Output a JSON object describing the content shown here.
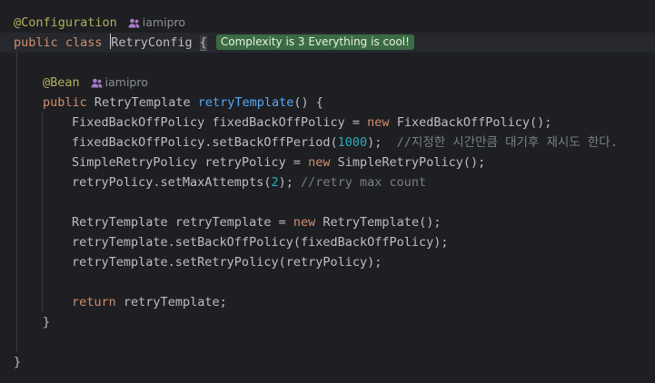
{
  "author": "iamipro",
  "complexity_badge": "Complexity is 3 Everything is cool!",
  "lines": {
    "l1": {
      "annotation": "@Configuration"
    },
    "l2": {
      "kw1": "public",
      "kw2": "class",
      "class_name": "RetryConfig",
      "brace": "{"
    },
    "l4": {
      "annotation": "@Bean"
    },
    "l5": {
      "kw": "public",
      "type": "RetryTemplate",
      "method": "retryTemplate",
      "rest": "() {"
    },
    "l6": {
      "type": "FixedBackOffPolicy",
      "var": "fixedBackOffPolicy =",
      "kw": "new",
      "ctor": "FixedBackOffPolicy();"
    },
    "l7": {
      "code_a": "fixedBackOffPolicy.setBackOffPeriod(",
      "num": "1000",
      "code_b": ");",
      "comment": "//지정한 시간만큼 대기후 재시도 한다."
    },
    "l8": {
      "type": "SimpleRetryPolicy",
      "var": "retryPolicy =",
      "kw": "new",
      "ctor": "SimpleRetryPolicy();"
    },
    "l9": {
      "code_a": "retryPolicy.setMaxAttempts(",
      "num": "2",
      "code_b": ");",
      "comment": "//retry max count"
    },
    "l11": {
      "type": "RetryTemplate",
      "var": "retryTemplate =",
      "kw": "new",
      "ctor": "RetryTemplate();"
    },
    "l12": {
      "code": "retryTemplate.setBackOffPolicy(fixedBackOffPolicy);"
    },
    "l13": {
      "code": "retryTemplate.setRetryPolicy(retryPolicy);"
    },
    "l15": {
      "kw": "return",
      "rest": "retryTemplate;"
    },
    "l16": {
      "brace": "}"
    },
    "l18": {
      "brace": "}"
    }
  }
}
